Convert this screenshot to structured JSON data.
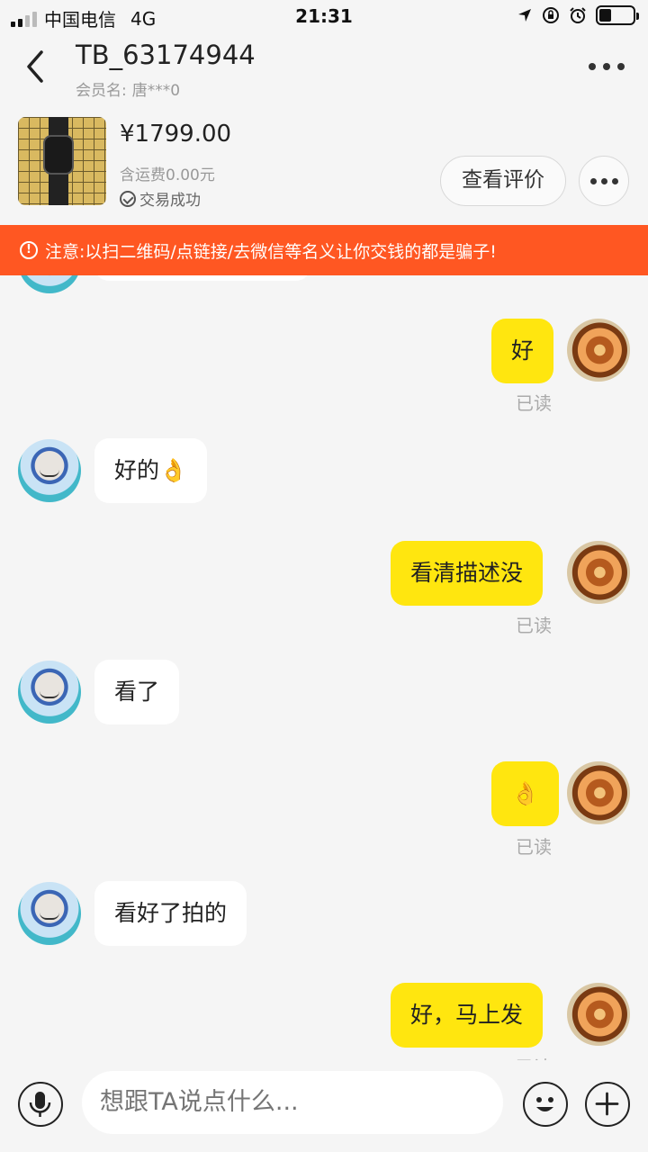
{
  "status_bar": {
    "carrier": "中国电信",
    "network": "4G",
    "time": "21:31"
  },
  "header": {
    "title": "TB_63174944",
    "member_label": "会员名:",
    "member_name": "唐***0"
  },
  "product": {
    "price": "¥1799.00",
    "shipping": "含运费0.00元",
    "status": "交易成功",
    "review_button": "查看评价"
  },
  "warning": {
    "text": "注意:以扫二维码/点链接/去微信等名义让你交钱的都是骗子!"
  },
  "messages": [
    {
      "side": "right",
      "text": "好",
      "read": "已读"
    },
    {
      "side": "left",
      "text": "好的👌"
    },
    {
      "side": "right",
      "text": "看清描述没",
      "read": "已读"
    },
    {
      "side": "left",
      "text": "看了"
    },
    {
      "side": "right",
      "text": "👌",
      "read": "已读"
    },
    {
      "side": "left",
      "text": "看好了拍的"
    },
    {
      "side": "right",
      "text": "好，马上发",
      "read": "已读"
    }
  ],
  "input_bar": {
    "placeholder": "想跟TA说点什么..."
  },
  "icons": {
    "back": "chevron-left-icon",
    "more": "more-icon",
    "mic": "microphone-icon",
    "emoji": "emoji-icon",
    "plus": "plus-icon"
  },
  "colors": {
    "own_bubble": "#ffe60f",
    "warning_bar": "#ff5722",
    "background": "#f5f5f5"
  }
}
